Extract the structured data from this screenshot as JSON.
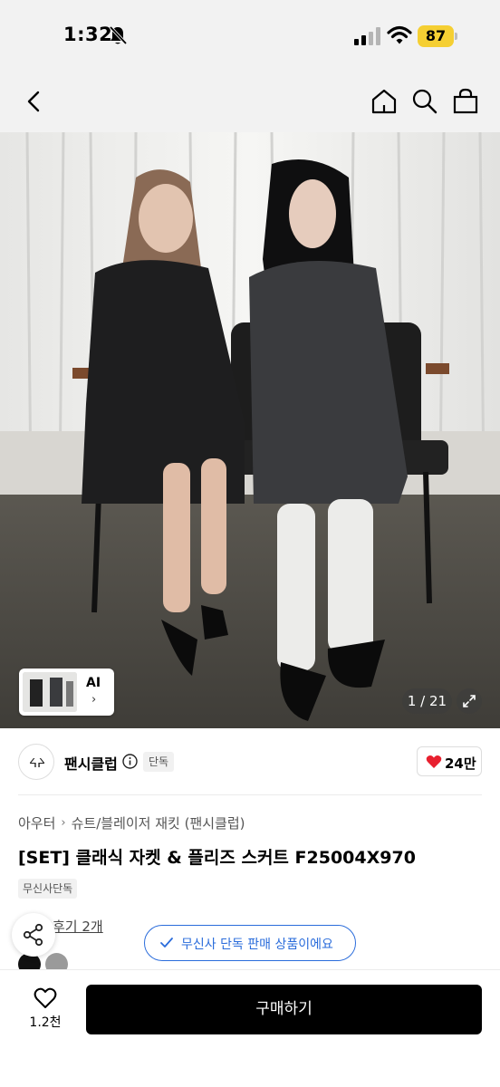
{
  "status_bar": {
    "time": "1:32",
    "battery": "87",
    "icons": [
      "bell-slash-icon",
      "signal-icon",
      "wifi-icon",
      "battery-icon"
    ]
  },
  "nav": {
    "icons": [
      "back-arrow-icon",
      "home-icon",
      "search-icon",
      "shopping-bag-icon"
    ]
  },
  "gallery": {
    "counter": "1 / 21",
    "ai_label": "AI",
    "ai_chevron": "›"
  },
  "brand": {
    "name": "팬시클럽",
    "badge": "단독",
    "like_count": "24만"
  },
  "breadcrumb": {
    "items": [
      "아우터",
      "슈트/블레이저 재킷 (팬시클럽)"
    ],
    "separator": "›"
  },
  "product": {
    "title": "[SET] 클래식 자켓 & 플리즈 스커트 F25004X970",
    "badge": "무신사단독",
    "review_link": "후기 2개",
    "swatch_colors": [
      "#111111",
      "#9a9a9a"
    ]
  },
  "toast": {
    "text": "무신사 단독 판매 상품이에요"
  },
  "bottom_bar": {
    "wish_count": "1.2천",
    "buy_label": "구매하기"
  },
  "colors": {
    "accent_blue": "#2a6cdb",
    "like_red": "#e8202f",
    "battery_yellow": "#f5cf33"
  }
}
